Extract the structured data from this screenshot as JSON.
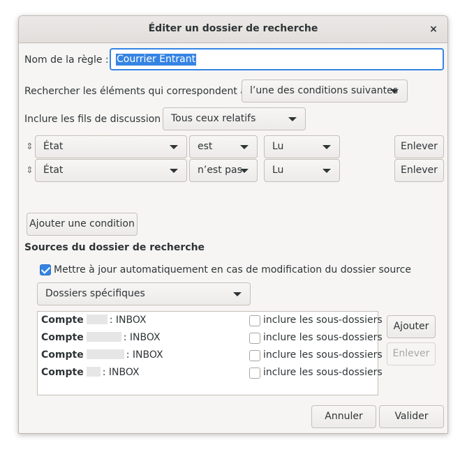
{
  "window": {
    "title": "Éditer un dossier de recherche",
    "close_glyph": "×"
  },
  "rule_name": {
    "label": "Nom de la règle :",
    "value": "Courrier Entrant"
  },
  "match": {
    "label": "Rechercher les éléments qui correspondent à :",
    "value": "l’une des conditions suivantes"
  },
  "threads": {
    "label": "Inclure les fils de discussion :",
    "value": "Tous ceux relatifs"
  },
  "conditions": [
    {
      "field": "État",
      "op": "est",
      "value": "Lu",
      "remove_label": "Enlever"
    },
    {
      "field": "État",
      "op": "n’est pas",
      "value": "Lu",
      "remove_label": "Enlever"
    }
  ],
  "add_condition_label": "Ajouter une condition",
  "sources": {
    "title": "Sources du dossier de recherche",
    "autoupdate_label": "Mettre à jour automatiquement en cas de modification du dossier source",
    "autoupdate_checked": true,
    "scope": "Dossiers spécifiques",
    "folders": [
      {
        "account": "Compte",
        "folder": ": INBOX",
        "include_label": "inclure les sous-dossiers"
      },
      {
        "account": "Compte",
        "folder": ": INBOX",
        "include_label": "inclure les sous-dossiers"
      },
      {
        "account": "Compte",
        "folder": ": INBOX",
        "include_label": "inclure les sous-dossiers"
      },
      {
        "account": "Compte",
        "folder": ": INBOX",
        "include_label": "inclure les sous-dossiers"
      }
    ],
    "add_label": "Ajouter",
    "remove_label": "Enlever"
  },
  "footer": {
    "cancel_label": "Annuler",
    "ok_label": "Valider"
  },
  "colors": {
    "accent": "#3584e4",
    "window_bg": "#f6f5f4"
  }
}
